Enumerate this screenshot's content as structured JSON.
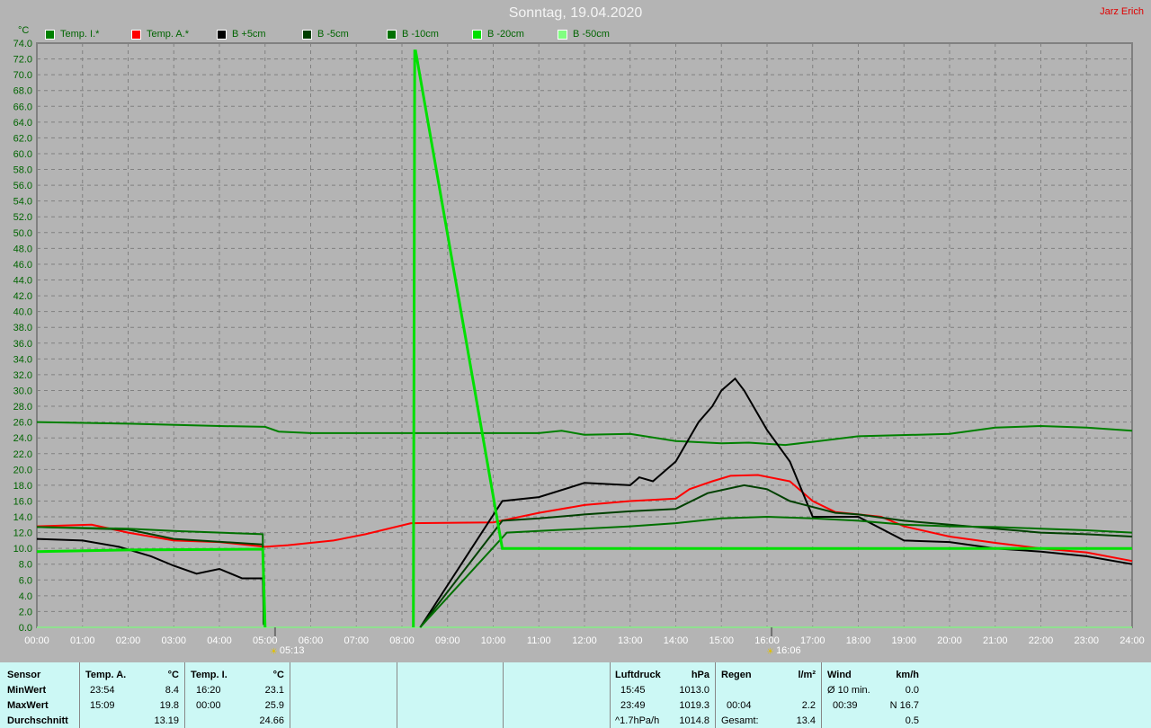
{
  "header": {
    "title": "Sonntag, 19.04.2020",
    "author": "Jarz Erich"
  },
  "chart_data": {
    "type": "line",
    "title": "Sonntag, 19.04.2020",
    "ylabel": "°C",
    "xlabel": "",
    "ylim": [
      0,
      74
    ],
    "xlim": [
      0,
      24
    ],
    "grid": true,
    "legend_position": "top",
    "y_ticks": [
      "0.0",
      "2.0",
      "4.0",
      "6.0",
      "8.0",
      "10.0",
      "12.0",
      "14.0",
      "16.0",
      "18.0",
      "20.0",
      "22.0",
      "24.0",
      "26.0",
      "28.0",
      "30.0",
      "32.0",
      "34.0",
      "36.0",
      "38.0",
      "40.0",
      "42.0",
      "44.0",
      "46.0",
      "48.0",
      "50.0",
      "52.0",
      "54.0",
      "56.0",
      "58.0",
      "60.0",
      "62.0",
      "64.0",
      "66.0",
      "68.0",
      "70.0",
      "72.0",
      "74.0"
    ],
    "x_ticks": [
      "00:00",
      "01:00",
      "02:00",
      "03:00",
      "04:00",
      "05:00",
      "06:00",
      "07:00",
      "08:00",
      "09:00",
      "10:00",
      "11:00",
      "12:00",
      "13:00",
      "14:00",
      "15:00",
      "16:00",
      "17:00",
      "18:00",
      "19:00",
      "20:00",
      "21:00",
      "22:00",
      "23:00",
      "24:00"
    ],
    "annotations": [
      {
        "label": "05:13",
        "x": 5.22,
        "icon": "sunrise-icon"
      },
      {
        "label": "16:06",
        "x": 16.1,
        "icon": "sunset-icon"
      }
    ],
    "series": [
      {
        "name": "Temp. I.*",
        "color": "#008000",
        "x": [
          0,
          2,
          4,
          5,
          5.3,
          6,
          8,
          11,
          11.5,
          12,
          13,
          14,
          15,
          15.6,
          16.4,
          17,
          18,
          20,
          21,
          22,
          23,
          24
        ],
        "y": [
          26,
          25.8,
          25.5,
          25.4,
          24.8,
          24.6,
          24.6,
          24.6,
          24.9,
          24.4,
          24.5,
          23.6,
          23.3,
          23.4,
          23.1,
          23.5,
          24.2,
          24.5,
          25.3,
          25.5,
          25.3,
          24.9
        ]
      },
      {
        "name": "Temp. A.*",
        "color": "#ff0000",
        "x": [
          0,
          1.2,
          2,
          3,
          4,
          5,
          5.5,
          6.5,
          7.2,
          8.2,
          10,
          11,
          12,
          13,
          14,
          14.3,
          14.8,
          15.2,
          15.8,
          16.5,
          17,
          17.5,
          18.5,
          19,
          20,
          21,
          22,
          23,
          24
        ],
        "y": [
          12.8,
          13,
          12,
          11,
          10.8,
          10.2,
          10.4,
          11,
          11.8,
          13.2,
          13.3,
          14.5,
          15.5,
          16,
          16.3,
          17.5,
          18.5,
          19.2,
          19.3,
          18.5,
          16,
          14.6,
          14,
          12.8,
          11.5,
          10.7,
          10,
          9.5,
          8.4
        ]
      },
      {
        "name": "B +5cm",
        "color": "#000000",
        "x": [
          0,
          1,
          1.8,
          2.5,
          3,
          3.5,
          4,
          4.5,
          4.95,
          4.97,
          null,
          8.4,
          10.2,
          11,
          12,
          13,
          13.2,
          13.5,
          14,
          14.5,
          14.8,
          15,
          15.3,
          15.5,
          16,
          16.5,
          17,
          18,
          19,
          20,
          21,
          22,
          23,
          24
        ],
        "y": [
          11.2,
          11,
          10.2,
          9,
          7.8,
          6.8,
          7.4,
          6.2,
          6.2,
          3,
          null,
          0,
          16,
          16.5,
          18.3,
          18,
          19,
          18.5,
          21,
          26,
          28,
          30,
          31.5,
          30,
          25,
          21,
          14,
          14,
          11,
          10.8,
          10,
          9.6,
          9,
          8
        ]
      },
      {
        "name": "B -5cm",
        "color": "#004000",
        "x": [
          0,
          2,
          3,
          4.95,
          4.97,
          null,
          8.4,
          10.2,
          11,
          12,
          13,
          14,
          14.7,
          15.5,
          16,
          16.5,
          17.5,
          18,
          19,
          20,
          21,
          22,
          23,
          24
        ],
        "y": [
          12.7,
          12.4,
          11.2,
          10.5,
          0.5,
          null,
          0,
          13.5,
          13.8,
          14.3,
          14.7,
          15,
          17,
          18,
          17.5,
          16,
          14.5,
          14.3,
          13.5,
          13,
          12.5,
          12,
          11.8,
          11.5
        ]
      },
      {
        "name": "B -10cm",
        "color": "#007000",
        "x": [
          0,
          2,
          3,
          4.95,
          4.97,
          null,
          8.4,
          10.3,
          11,
          12,
          13,
          14,
          15,
          16,
          17,
          18,
          19,
          20,
          21,
          22,
          23,
          24
        ],
        "y": [
          12.7,
          12.5,
          12.2,
          11.8,
          0.3,
          null,
          0,
          12,
          12.2,
          12.5,
          12.8,
          13.2,
          13.8,
          14,
          13.8,
          13.5,
          13,
          12.8,
          12.7,
          12.5,
          12.3,
          12
        ]
      },
      {
        "name": "B -20cm",
        "color": "#00e000",
        "x": [
          0,
          2,
          4.95,
          5.0,
          null,
          8.25,
          8.28,
          8.3,
          10.2,
          12,
          16,
          20,
          24
        ],
        "y": [
          9.6,
          9.8,
          9.9,
          0,
          null,
          0,
          73,
          73,
          10,
          10,
          10,
          10,
          10
        ]
      },
      {
        "name": "B -50cm",
        "color": "#80ff80",
        "x": [],
        "y": []
      }
    ]
  },
  "stats": {
    "sensor": {
      "header": "Sensor",
      "rows": [
        "MinWert",
        "MaxWert",
        "Durchschnitt"
      ]
    },
    "temp_a": {
      "header": "Temp. A.",
      "unit": "°C",
      "min_time": "23:54",
      "min": "8.4",
      "max_time": "15:09",
      "max": "19.8",
      "avg": "13.19"
    },
    "temp_i": {
      "header": "Temp. I.",
      "unit": "°C",
      "min_time": "16:20",
      "min": "23.1",
      "max_time": "00:00",
      "max": "25.9",
      "avg": "24.66"
    },
    "pressure": {
      "header": "Luftdruck",
      "unit": "hPa",
      "r1a": "15:45",
      "r1b": "1013.0",
      "r2a": "23:49",
      "r2b": "1019.3",
      "r3a": "^1.7hPa/h",
      "r3b": "1014.8"
    },
    "rain": {
      "header": "Regen",
      "unit": "l/m²",
      "r2a": "00:04",
      "r2b": "2.2",
      "r3a": "Gesamt:",
      "r3b": "13.4"
    },
    "wind": {
      "header": "Wind",
      "unit": "km/h",
      "r1a": "Ø 10 min.",
      "r1b": "0.0",
      "r2a": "00:39",
      "r2b": "N 16.7",
      "r3b": "0.5"
    }
  }
}
